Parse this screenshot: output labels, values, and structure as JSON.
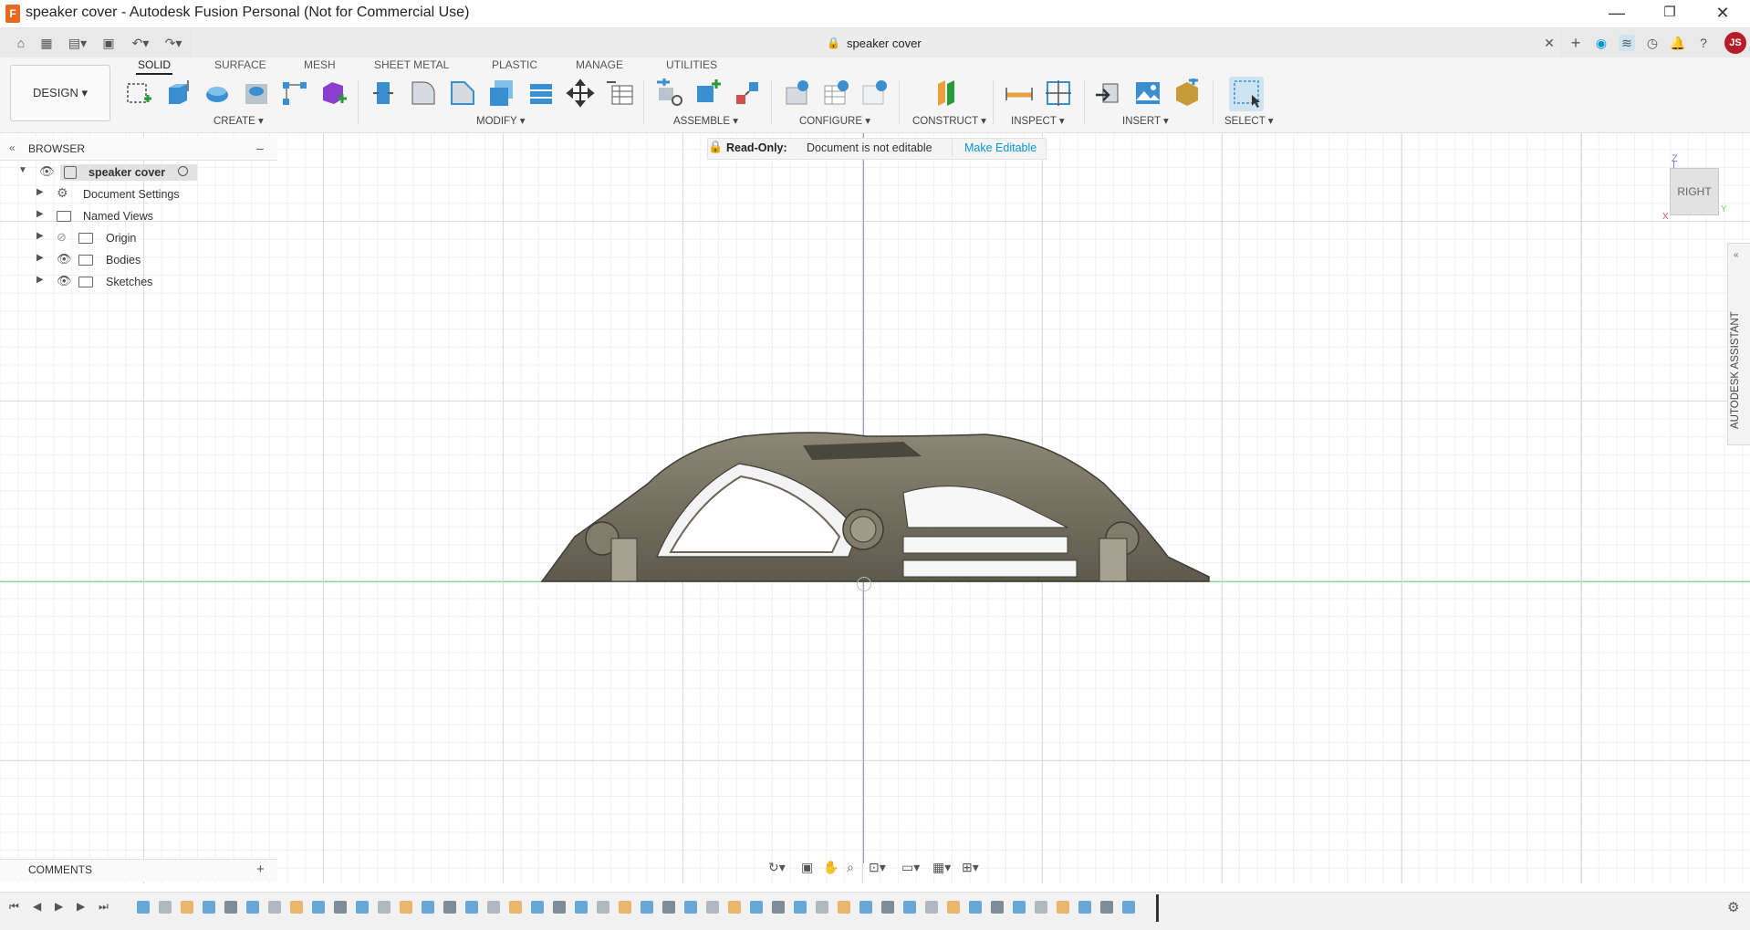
{
  "window": {
    "title": "speaker cover - Autodesk Fusion Personal (Not for Commercial Use)",
    "app_icon_letter": "F",
    "minimize": "—",
    "restore": "❐",
    "close": "✕"
  },
  "doc_tab": {
    "title": "speaker cover",
    "close": "✕",
    "new": "+"
  },
  "user": {
    "initials": "JS"
  },
  "workspace": {
    "label": "DESIGN ▾"
  },
  "tabs": [
    "SOLID",
    "SURFACE",
    "MESH",
    "SHEET METAL",
    "PLASTIC",
    "MANAGE",
    "UTILITIES"
  ],
  "groups": [
    "CREATE ▾",
    "MODIFY ▾",
    "ASSEMBLE ▾",
    "CONFIGURE ▾",
    "CONSTRUCT ▾",
    "INSPECT ▾",
    "INSERT ▾",
    "SELECT ▾"
  ],
  "browser": {
    "title": "BROWSER",
    "collapse": "«",
    "minimize": "–",
    "root": "speaker cover",
    "items": [
      "Document Settings",
      "Named Views",
      "Origin",
      "Bodies",
      "Sketches"
    ]
  },
  "readonly": {
    "label": "Read-Only:",
    "message": "Document is not editable",
    "action": "Make Editable"
  },
  "viewcube": {
    "face": "RIGHT",
    "axis_z": "Z",
    "axis_y": "Y",
    "axis_x": "X"
  },
  "assistant": {
    "label": "AUTODESK ASSISTANT"
  },
  "comments": {
    "label": "COMMENTS",
    "add": "+"
  },
  "colors": {
    "accent": "#0696d7",
    "model": "#7a7566",
    "x_axis": "#e35959",
    "y_axis": "#6fd66f",
    "z_axis": "#7b7bdc"
  }
}
